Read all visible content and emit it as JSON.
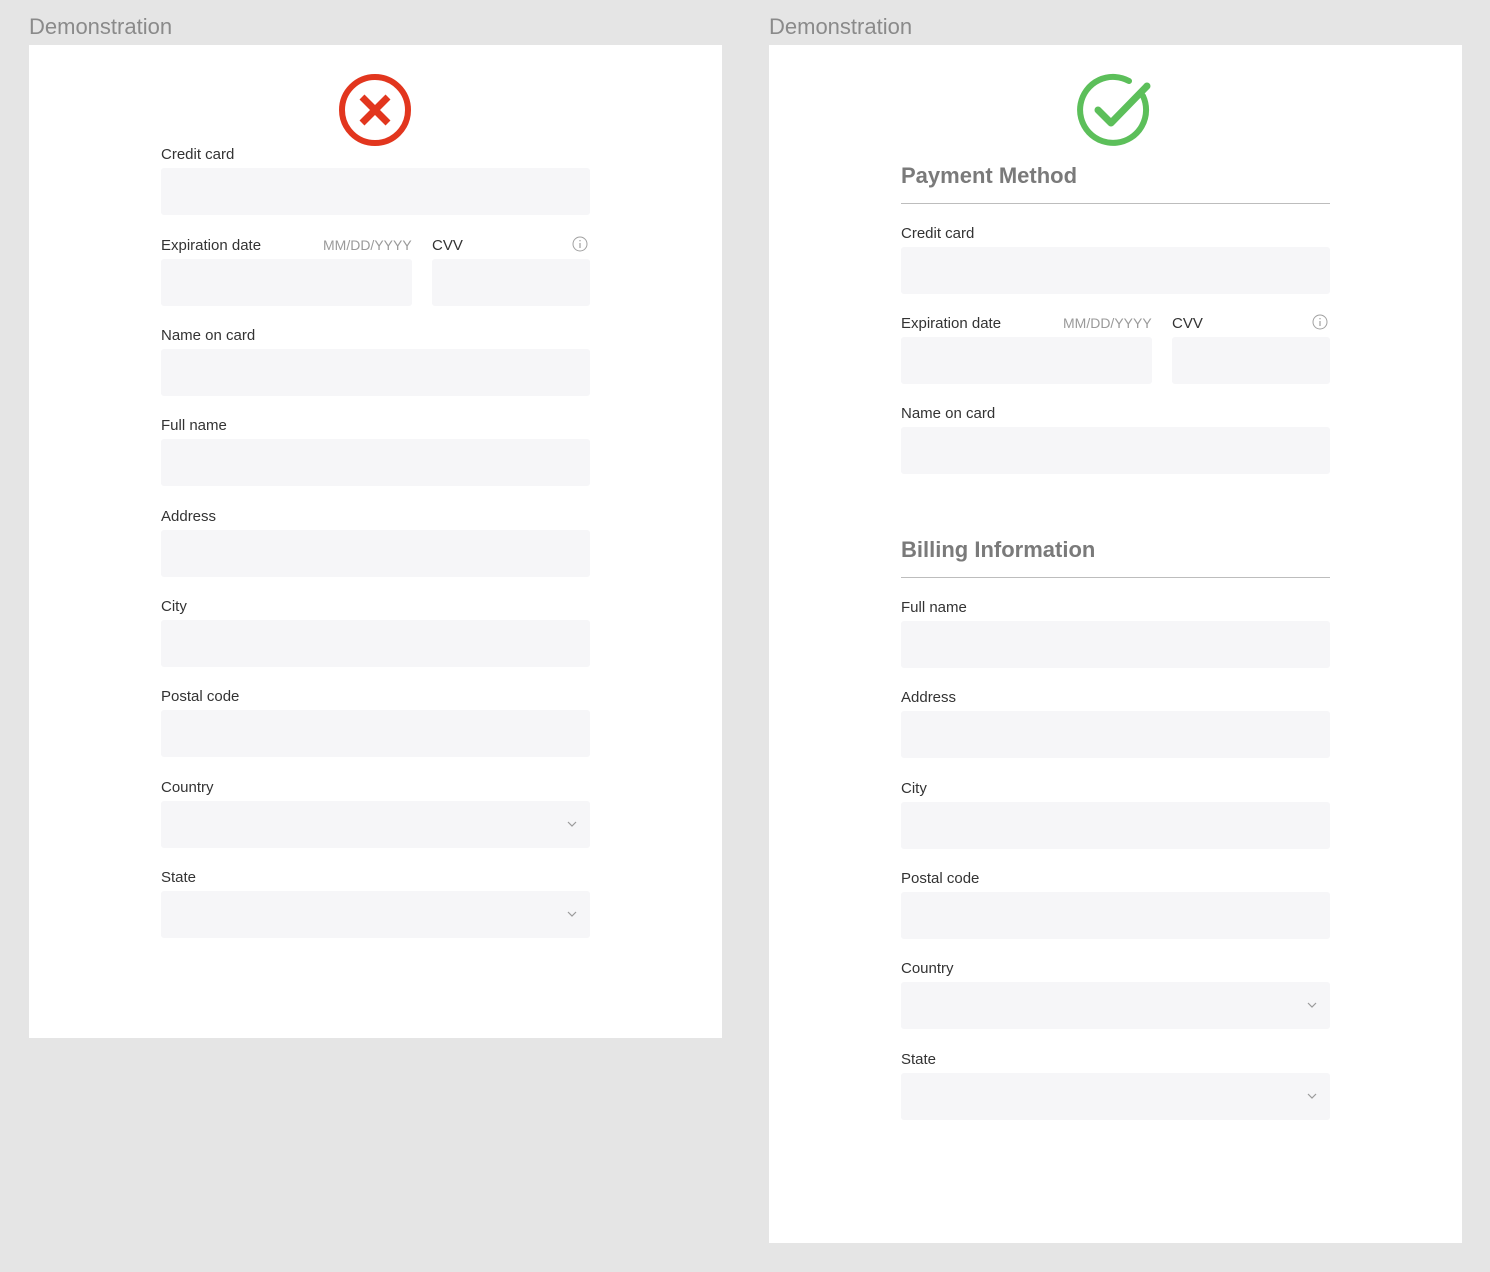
{
  "colors": {
    "canvas": "#e5e5e5",
    "artboard": "#ffffff",
    "field_bg": "#f6f6f8",
    "error_icon": "#e2361e",
    "success_icon": "#5cbf5a",
    "section_title": "#7a7a7a"
  },
  "left_panel": {
    "frame_title": "Demonstration",
    "status_icon": "error-x-circle-icon",
    "credit_card": "Credit card",
    "expiration_date": "Expiration date",
    "expiration_hint": "MM/DD/YYYY",
    "cvv": "CVV",
    "cvv_icon": "info-icon",
    "name_on_card": "Name on card",
    "full_name": "Full name",
    "address": "Address",
    "city": "City",
    "postal_code": "Postal code",
    "country": "Country",
    "state": "State",
    "select_icon": "chevron-down-icon"
  },
  "right_panel": {
    "frame_title": "Demonstration",
    "status_icon": "success-check-circle-icon",
    "payment_title": "Payment Method",
    "credit_card": "Credit card",
    "expiration_date": "Expiration date",
    "expiration_hint": "MM/DD/YYYY",
    "cvv": "CVV",
    "cvv_icon": "info-icon",
    "name_on_card": "Name on card",
    "billing_title": "Billing Information",
    "full_name": "Full name",
    "address": "Address",
    "city": "City",
    "postal_code": "Postal code",
    "country": "Country",
    "state": "State",
    "select_icon": "chevron-down-icon"
  }
}
